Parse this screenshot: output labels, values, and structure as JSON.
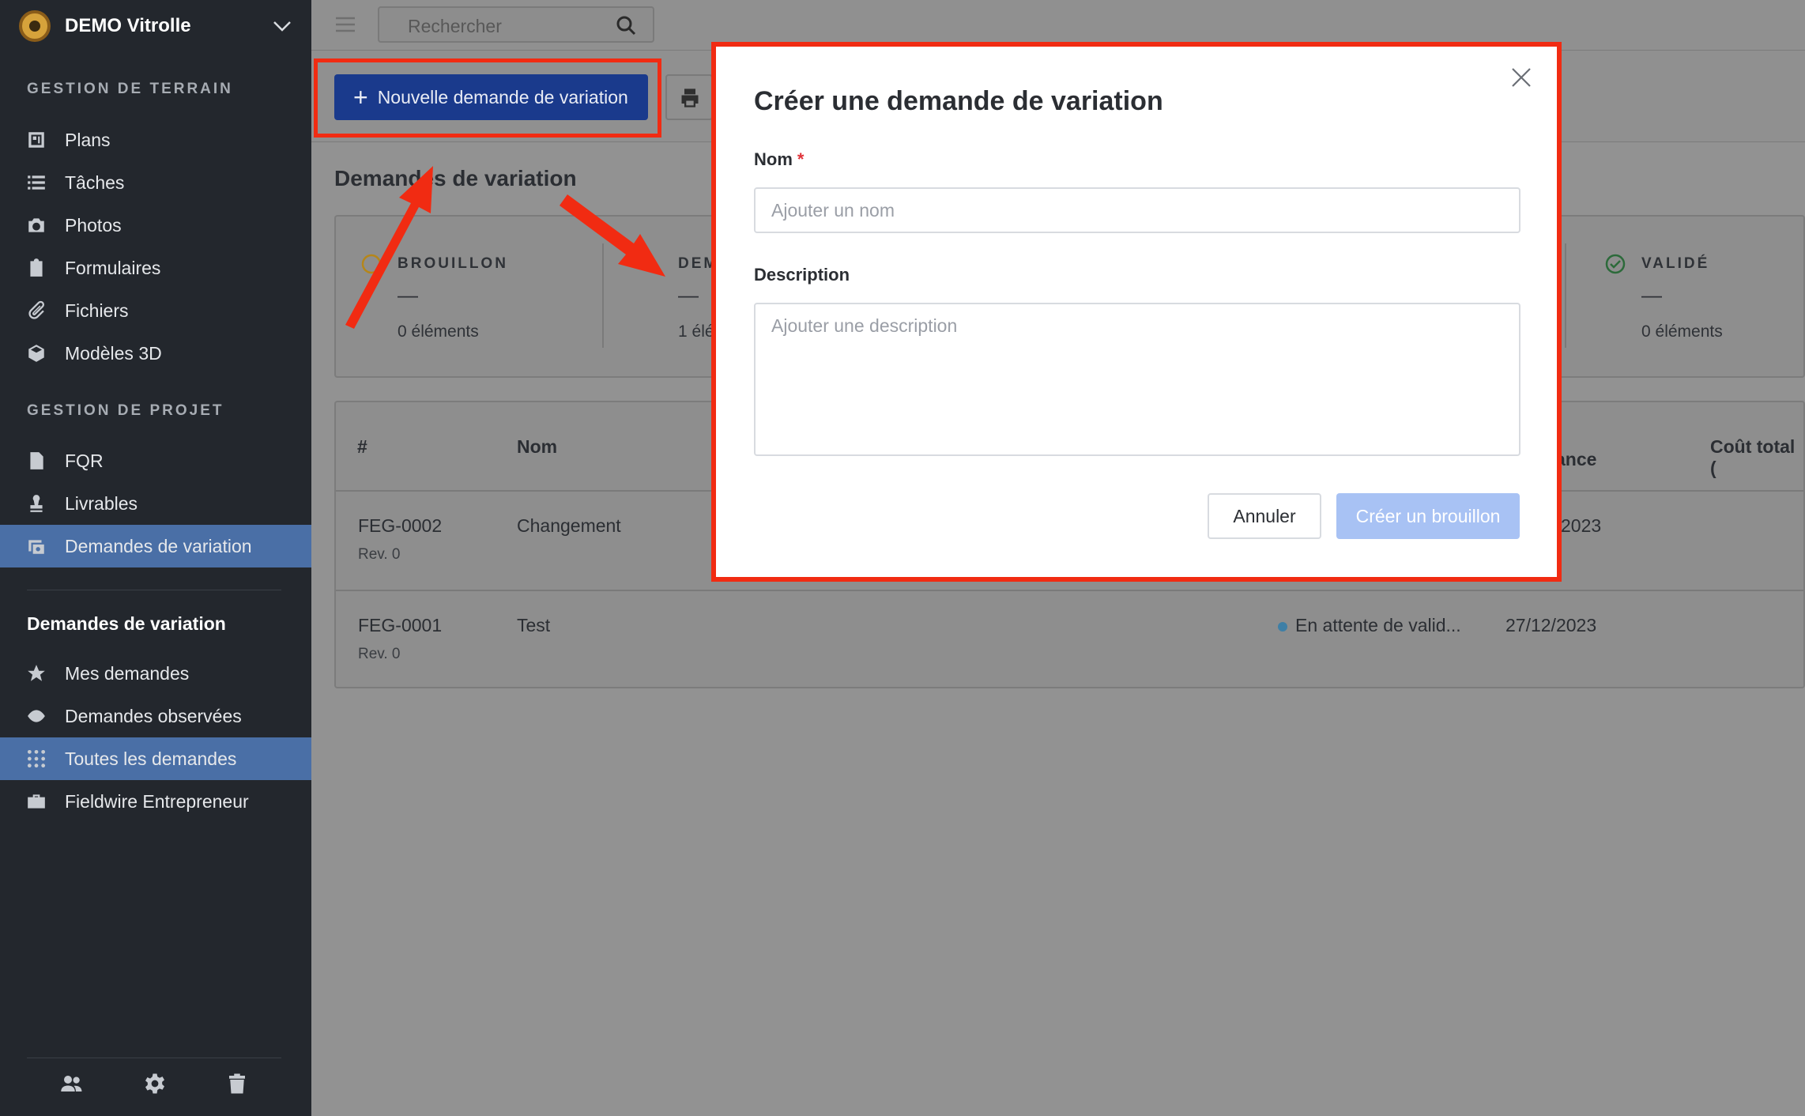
{
  "project": {
    "name": "DEMO Vitrolle"
  },
  "sidebar": {
    "section_terrain": "GESTION DE TERRAIN",
    "terrain_items": [
      {
        "label": "Plans",
        "icon": "plans-icon"
      },
      {
        "label": "Tâches",
        "icon": "list-icon"
      },
      {
        "label": "Photos",
        "icon": "camera-icon"
      },
      {
        "label": "Formulaires",
        "icon": "clipboard-icon"
      },
      {
        "label": "Fichiers",
        "icon": "paperclip-icon"
      },
      {
        "label": "Modèles 3D",
        "icon": "cube-icon"
      }
    ],
    "section_projet": "GESTION DE PROJET",
    "projet_items": [
      {
        "label": "FQR",
        "icon": "document-info-icon"
      },
      {
        "label": "Livrables",
        "icon": "stamp-icon"
      },
      {
        "label": "Demandes de variation",
        "icon": "variation-icon",
        "active": true
      }
    ],
    "sub_title": "Demandes de variation",
    "sub_items": [
      {
        "label": "Mes demandes",
        "icon": "star-icon"
      },
      {
        "label": "Demandes observées",
        "icon": "eye-icon"
      },
      {
        "label": "Toutes les demandes",
        "icon": "grid-icon",
        "active": true
      },
      {
        "label": "Fieldwire Entrepreneur",
        "icon": "briefcase-icon"
      }
    ]
  },
  "topbar": {
    "search_placeholder": "Rechercher"
  },
  "toolbar": {
    "new_button": "Nouvelle demande de variation",
    "plus": "+"
  },
  "page": {
    "title": "Demandes de variation"
  },
  "status": [
    {
      "label": "BROUILLON",
      "dash": "—",
      "count": "0 éléments"
    },
    {
      "label": "DEM",
      "dash": "—",
      "count": "1 élé"
    },
    {
      "label": "VALIDÉ",
      "dash": "—",
      "count": "0 éléments"
    }
  ],
  "table": {
    "headers": {
      "num": "#",
      "name": "Nom",
      "due": "ance",
      "total": "Coût total ("
    },
    "rows": [
      {
        "id": "FEG-0002",
        "rev": "Rev. 0",
        "name": "Changement",
        "status": "",
        "date": "2023"
      },
      {
        "id": "FEG-0001",
        "rev": "Rev. 0",
        "name": "Test",
        "status": "En attente de valid...",
        "date": "27/12/2023"
      }
    ]
  },
  "modal": {
    "title": "Créer une demande de variation",
    "name_label": "Nom",
    "required_mark": "*",
    "name_placeholder": "Ajouter un nom",
    "desc_label": "Description",
    "desc_placeholder": "Ajouter une description",
    "cancel": "Annuler",
    "create": "Créer un brouillon"
  },
  "colors": {
    "highlight": "#f12b12",
    "primary": "#1a49d6",
    "disabled_primary": "#a8c2f4"
  }
}
